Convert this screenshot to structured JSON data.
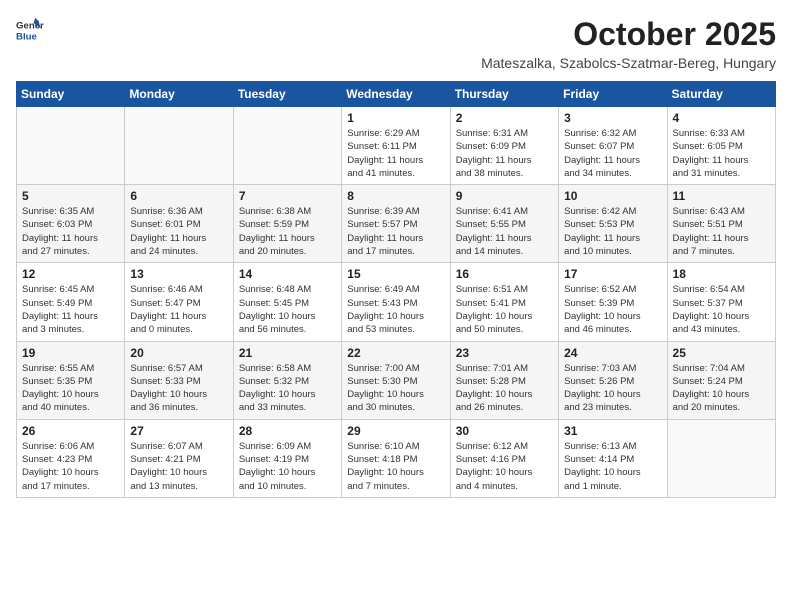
{
  "header": {
    "logo_general": "General",
    "logo_blue": "Blue",
    "month_title": "October 2025",
    "location": "Mateszalka, Szabolcs-Szatmar-Bereg, Hungary"
  },
  "weekdays": [
    "Sunday",
    "Monday",
    "Tuesday",
    "Wednesday",
    "Thursday",
    "Friday",
    "Saturday"
  ],
  "weeks": [
    [
      {
        "day": "",
        "info": ""
      },
      {
        "day": "",
        "info": ""
      },
      {
        "day": "",
        "info": ""
      },
      {
        "day": "1",
        "info": "Sunrise: 6:29 AM\nSunset: 6:11 PM\nDaylight: 11 hours\nand 41 minutes."
      },
      {
        "day": "2",
        "info": "Sunrise: 6:31 AM\nSunset: 6:09 PM\nDaylight: 11 hours\nand 38 minutes."
      },
      {
        "day": "3",
        "info": "Sunrise: 6:32 AM\nSunset: 6:07 PM\nDaylight: 11 hours\nand 34 minutes."
      },
      {
        "day": "4",
        "info": "Sunrise: 6:33 AM\nSunset: 6:05 PM\nDaylight: 11 hours\nand 31 minutes."
      }
    ],
    [
      {
        "day": "5",
        "info": "Sunrise: 6:35 AM\nSunset: 6:03 PM\nDaylight: 11 hours\nand 27 minutes."
      },
      {
        "day": "6",
        "info": "Sunrise: 6:36 AM\nSunset: 6:01 PM\nDaylight: 11 hours\nand 24 minutes."
      },
      {
        "day": "7",
        "info": "Sunrise: 6:38 AM\nSunset: 5:59 PM\nDaylight: 11 hours\nand 20 minutes."
      },
      {
        "day": "8",
        "info": "Sunrise: 6:39 AM\nSunset: 5:57 PM\nDaylight: 11 hours\nand 17 minutes."
      },
      {
        "day": "9",
        "info": "Sunrise: 6:41 AM\nSunset: 5:55 PM\nDaylight: 11 hours\nand 14 minutes."
      },
      {
        "day": "10",
        "info": "Sunrise: 6:42 AM\nSunset: 5:53 PM\nDaylight: 11 hours\nand 10 minutes."
      },
      {
        "day": "11",
        "info": "Sunrise: 6:43 AM\nSunset: 5:51 PM\nDaylight: 11 hours\nand 7 minutes."
      }
    ],
    [
      {
        "day": "12",
        "info": "Sunrise: 6:45 AM\nSunset: 5:49 PM\nDaylight: 11 hours\nand 3 minutes."
      },
      {
        "day": "13",
        "info": "Sunrise: 6:46 AM\nSunset: 5:47 PM\nDaylight: 11 hours\nand 0 minutes."
      },
      {
        "day": "14",
        "info": "Sunrise: 6:48 AM\nSunset: 5:45 PM\nDaylight: 10 hours\nand 56 minutes."
      },
      {
        "day": "15",
        "info": "Sunrise: 6:49 AM\nSunset: 5:43 PM\nDaylight: 10 hours\nand 53 minutes."
      },
      {
        "day": "16",
        "info": "Sunrise: 6:51 AM\nSunset: 5:41 PM\nDaylight: 10 hours\nand 50 minutes."
      },
      {
        "day": "17",
        "info": "Sunrise: 6:52 AM\nSunset: 5:39 PM\nDaylight: 10 hours\nand 46 minutes."
      },
      {
        "day": "18",
        "info": "Sunrise: 6:54 AM\nSunset: 5:37 PM\nDaylight: 10 hours\nand 43 minutes."
      }
    ],
    [
      {
        "day": "19",
        "info": "Sunrise: 6:55 AM\nSunset: 5:35 PM\nDaylight: 10 hours\nand 40 minutes."
      },
      {
        "day": "20",
        "info": "Sunrise: 6:57 AM\nSunset: 5:33 PM\nDaylight: 10 hours\nand 36 minutes."
      },
      {
        "day": "21",
        "info": "Sunrise: 6:58 AM\nSunset: 5:32 PM\nDaylight: 10 hours\nand 33 minutes."
      },
      {
        "day": "22",
        "info": "Sunrise: 7:00 AM\nSunset: 5:30 PM\nDaylight: 10 hours\nand 30 minutes."
      },
      {
        "day": "23",
        "info": "Sunrise: 7:01 AM\nSunset: 5:28 PM\nDaylight: 10 hours\nand 26 minutes."
      },
      {
        "day": "24",
        "info": "Sunrise: 7:03 AM\nSunset: 5:26 PM\nDaylight: 10 hours\nand 23 minutes."
      },
      {
        "day": "25",
        "info": "Sunrise: 7:04 AM\nSunset: 5:24 PM\nDaylight: 10 hours\nand 20 minutes."
      }
    ],
    [
      {
        "day": "26",
        "info": "Sunrise: 6:06 AM\nSunset: 4:23 PM\nDaylight: 10 hours\nand 17 minutes."
      },
      {
        "day": "27",
        "info": "Sunrise: 6:07 AM\nSunset: 4:21 PM\nDaylight: 10 hours\nand 13 minutes."
      },
      {
        "day": "28",
        "info": "Sunrise: 6:09 AM\nSunset: 4:19 PM\nDaylight: 10 hours\nand 10 minutes."
      },
      {
        "day": "29",
        "info": "Sunrise: 6:10 AM\nSunset: 4:18 PM\nDaylight: 10 hours\nand 7 minutes."
      },
      {
        "day": "30",
        "info": "Sunrise: 6:12 AM\nSunset: 4:16 PM\nDaylight: 10 hours\nand 4 minutes."
      },
      {
        "day": "31",
        "info": "Sunrise: 6:13 AM\nSunset: 4:14 PM\nDaylight: 10 hours\nand 1 minute."
      },
      {
        "day": "",
        "info": ""
      }
    ]
  ]
}
